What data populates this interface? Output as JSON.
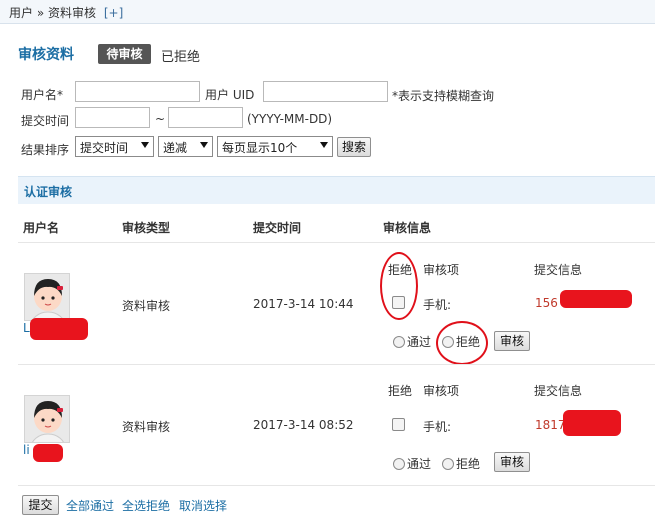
{
  "breadcrumb": {
    "parent": "用户",
    "sep": "»",
    "current": "资料审核",
    "add": "[+]"
  },
  "title": "审核资料",
  "tabs": {
    "pending": "待审核",
    "rejected": "已拒绝"
  },
  "form": {
    "username_label": "用户名*",
    "uid_label": "用户 UID",
    "fuzzy_hint": "*表示支持模糊查询",
    "time_label": "提交时间",
    "tilde": "~",
    "date_hint": "(YYYY-MM-DD)",
    "sort_label": "结果排序",
    "sort_field": "提交时间",
    "sort_order": "递减",
    "per_page": "每页显示10个",
    "search_button": "搜索"
  },
  "section_title": "认证审核",
  "columns": [
    "用户名",
    "审核类型",
    "提交时间",
    "审核信息"
  ],
  "sub_headers": {
    "reject": "拒绝",
    "item": "审核项",
    "info": "提交信息"
  },
  "rows": [
    {
      "user": "L",
      "type": "资料审核",
      "time": "2017-3-14 10:44",
      "field": "手机:",
      "value": "156",
      "approve": "通过",
      "reject": "拒绝",
      "audit": "审核"
    },
    {
      "user": "li",
      "type": "资料审核",
      "time": "2017-3-14 08:52",
      "field": "手机:",
      "value": "1817",
      "approve": "通过",
      "reject": "拒绝",
      "audit": "审核"
    }
  ],
  "footer": {
    "submit": "提交",
    "approve_all": "全部通过",
    "reject_all": "全选拒绝",
    "cancel": "取消选择"
  },
  "colors": {
    "accent": "#1c6ea4",
    "annotation": "#e0101a"
  }
}
